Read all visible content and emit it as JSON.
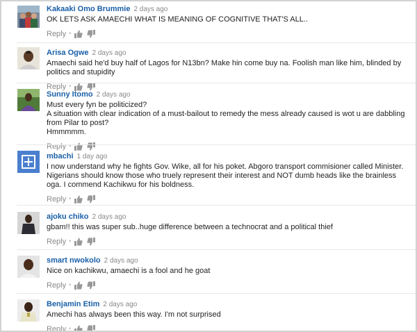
{
  "comments": [
    {
      "author": "Kakaaki Omo Brummie",
      "time": "2 days ago",
      "text": [
        "OK LETS ASK AMAECHI WHAT IS MEANING OF COGNITIVE THAT'S ALL.."
      ],
      "reply_label": "Reply",
      "avatar": "group-photo-avatar"
    },
    {
      "author": "Arisa Ogwe",
      "time": "2 days ago",
      "text": [
        "Amaechi said he'd buy half of Lagos for N13bn? Make hin come buy na. Foolish man like him, blinded by politics and stupidity"
      ],
      "reply_label": "Reply",
      "avatar": "person-photo-avatar"
    },
    {
      "author": "Sunny Itomo",
      "time": "2 days ago",
      "text": [
        "Must every fyn be politicized?",
        "A situation with clear indication of a must-bailout to remedy the mess already caused is wot u are dabbling from Pilar to post?",
        "Hmmmmm."
      ],
      "reply_label": "Reply",
      "avatar": "person-photo-avatar"
    },
    {
      "author": "mbachi",
      "time": "1 day ago",
      "text": [
        "I now understand why he fights Gov. Wike, all for his poket. Abgoro transport commisioner called Minister. Nigerians should know those who truely represent their interest and NOT dumb heads like the brainless oga. I commend Kachikwu for his boldness."
      ],
      "reply_label": "Reply",
      "avatar": "default-plus-avatar"
    },
    {
      "author": "ajoku chiko",
      "time": "2 days ago",
      "text": [
        "gbam!! this was super sub..huge difference between a technocrat and a political thief"
      ],
      "reply_label": "Reply",
      "avatar": "person-photo-avatar"
    },
    {
      "author": "smart nwokolo",
      "time": "2 days ago",
      "text": [
        "Nice on kachikwu, amaechi is a fool and he goat"
      ],
      "reply_label": "Reply",
      "avatar": "person-photo-avatar"
    },
    {
      "author": "Benjamin Etim",
      "time": "2 days ago",
      "text": [
        "Amechi has always been this way. I'm not surprised"
      ],
      "reply_label": "Reply",
      "avatar": "person-photo-avatar"
    }
  ],
  "icons": {
    "dot": "•",
    "like": "thumbs-up-icon",
    "dislike": "thumbs-down-icon"
  },
  "colors": {
    "author": "#1a5fa8",
    "muted": "#888888",
    "default_avatar": "#4a7fcf"
  }
}
